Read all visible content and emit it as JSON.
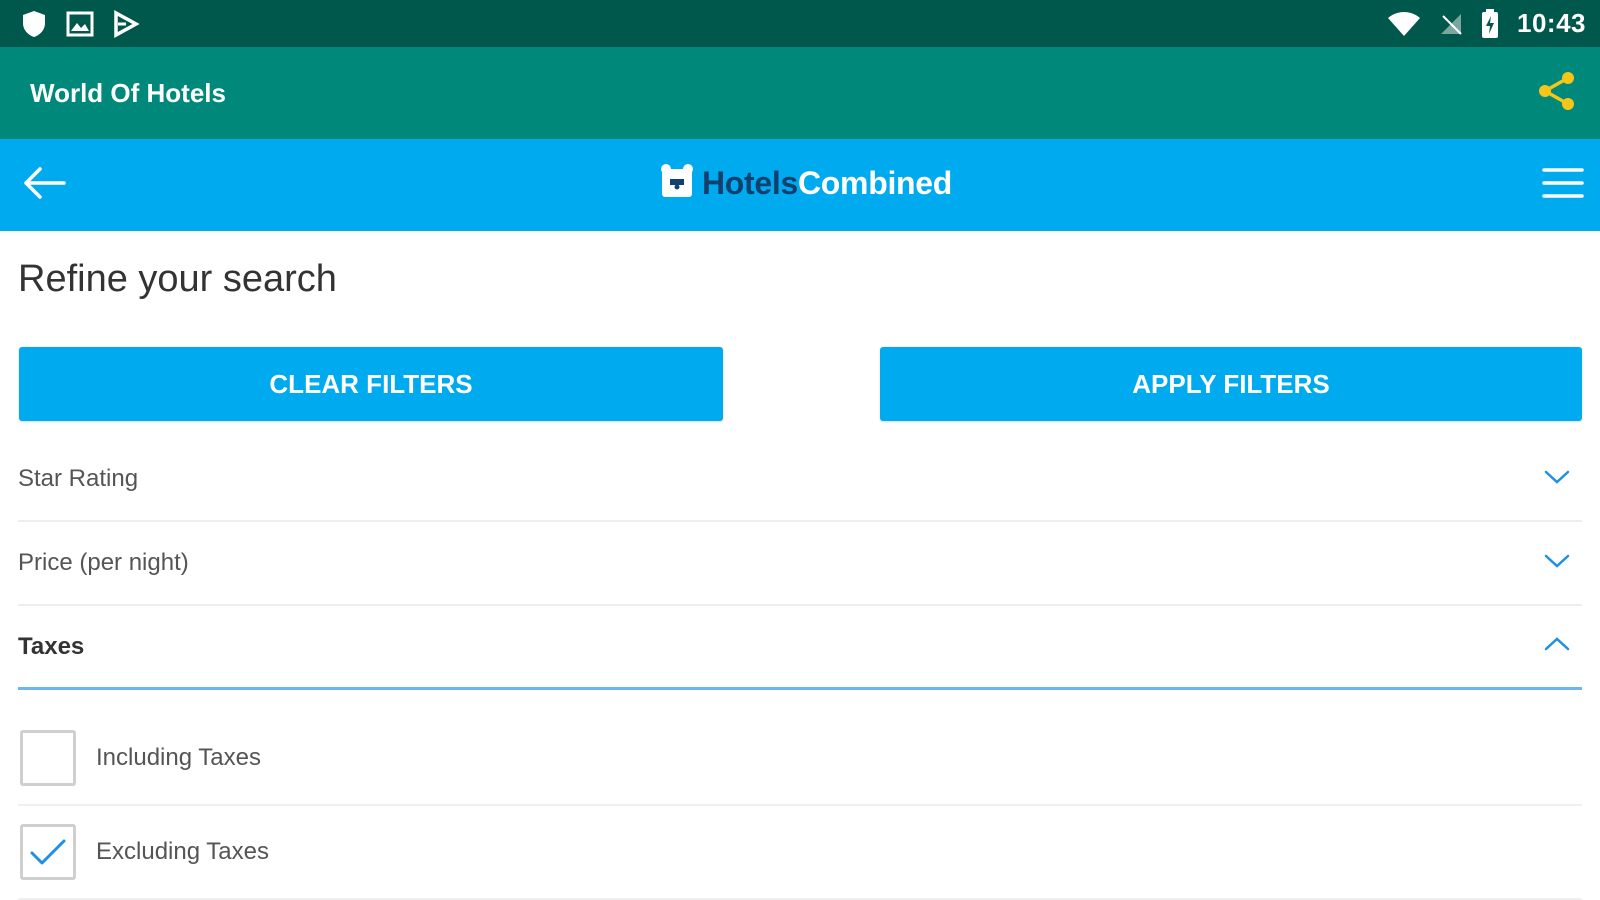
{
  "status_bar": {
    "time": "10:43",
    "left_icons": [
      "shield-icon",
      "image-icon",
      "play-store-icon"
    ],
    "right_icons": [
      "wifi-icon",
      "no-signal-icon",
      "battery-charging-icon"
    ]
  },
  "app_bar": {
    "title": "World Of Hotels",
    "share_icon": "share-icon",
    "accent_color": "#f5c518"
  },
  "site_header": {
    "brand_part1": "Hotels",
    "brand_part2": "Combined",
    "back_icon": "arrow-left-icon",
    "menu_icon": "hamburger-menu-icon"
  },
  "page": {
    "title": "Refine your search",
    "clear_button": "CLEAR FILTERS",
    "apply_button": "APPLY FILTERS"
  },
  "filters": [
    {
      "label": "Star Rating",
      "expanded": false
    },
    {
      "label": "Price (per night)",
      "expanded": false
    },
    {
      "label": "Taxes",
      "expanded": true
    }
  ],
  "tax_options": [
    {
      "label": "Including Taxes",
      "checked": false
    },
    {
      "label": "Excluding Taxes",
      "checked": true
    }
  ],
  "colors": {
    "status_bar": "#00574b",
    "app_bar": "#00897b",
    "primary": "#00aaee",
    "brand_dark": "#10406e"
  }
}
